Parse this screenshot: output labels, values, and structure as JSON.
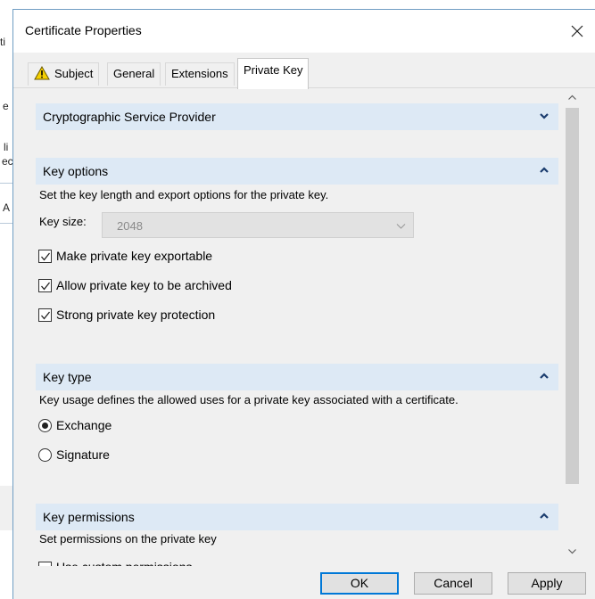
{
  "background_fragments": [
    "ti",
    "e",
    "li",
    "ec",
    "A"
  ],
  "dialog": {
    "title": "Certificate Properties",
    "close_glyph": "✕"
  },
  "tabs": [
    {
      "label": "Subject",
      "icon": "warning-icon",
      "active": false
    },
    {
      "label": "General",
      "active": false
    },
    {
      "label": "Extensions",
      "active": false
    },
    {
      "label": "Private Key",
      "active": true
    }
  ],
  "sections": {
    "csp": {
      "label": "Cryptographic Service Provider",
      "state": "collapsed"
    },
    "key_options": {
      "label": "Key options",
      "state": "expanded",
      "description": "Set the key length and export options for the private key.",
      "key_size_label": "Key size:",
      "key_size_value": "2048",
      "checkboxes": [
        {
          "label": "Make private key exportable",
          "checked": true
        },
        {
          "label": "Allow private key to be archived",
          "checked": true
        },
        {
          "label": "Strong private key protection",
          "checked": true
        }
      ]
    },
    "key_type": {
      "label": "Key type",
      "state": "expanded",
      "description": "Key usage defines the allowed uses for a private key associated with a certificate.",
      "radios": [
        {
          "label": "Exchange",
          "selected": true
        },
        {
          "label": "Signature",
          "selected": false
        }
      ]
    },
    "key_permissions": {
      "label": "Key permissions",
      "state": "expanded",
      "description": "Set permissions on the private key",
      "partial_label": "Use custom permissions"
    }
  },
  "buttons": {
    "ok": "OK",
    "cancel": "Cancel",
    "apply": "Apply"
  },
  "colors": {
    "section_header": "#dde9f5",
    "panel": "#f0f0f0",
    "accent": "#0078d7",
    "chevron": "#1a3c6e"
  }
}
